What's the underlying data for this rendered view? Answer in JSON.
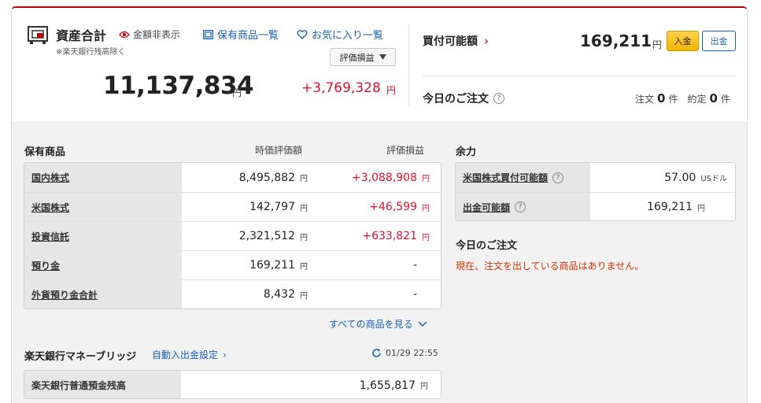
{
  "header": {
    "asset_title": "資産合計",
    "hide_amount_label": "金額非表示",
    "asset_note": "※楽天銀行残高除く",
    "link_holdings": "保有商品一覧",
    "link_favorites": "お気に入り一覧",
    "pl_select": "評価損益",
    "total_value": "11,137,834",
    "total_currency": "円",
    "total_pl": "+3,769,328",
    "total_pl_currency": "円"
  },
  "buying_power": {
    "label": "買付可能額",
    "value": "169,211",
    "currency": "円",
    "deposit_button": "入金",
    "withdraw_button": "出金"
  },
  "today_orders_top": {
    "label": "今日のご注文",
    "orders_label": "注文",
    "orders_count": "0",
    "orders_unit": "件",
    "executed_label": "約定",
    "executed_count": "0",
    "executed_unit": "件"
  },
  "holdings": {
    "title": "保有商品",
    "col_market_value": "時価評価額",
    "col_pl": "評価損益",
    "rows": [
      {
        "label": "国内株式",
        "value": "8,495,882",
        "currency": "円",
        "pl": "+3,088,908",
        "pl_currency": "円"
      },
      {
        "label": "米国株式",
        "value": "142,797",
        "currency": "円",
        "pl": "+46,599",
        "pl_currency": "円"
      },
      {
        "label": "投資信託",
        "value": "2,321,512",
        "currency": "円",
        "pl": "+633,821",
        "pl_currency": "円"
      },
      {
        "label": "預り金",
        "value": "169,211",
        "currency": "円",
        "pl": "-",
        "pl_currency": ""
      },
      {
        "label": "外貨預り金合計",
        "value": "8,432",
        "currency": "円",
        "pl": "-",
        "pl_currency": ""
      }
    ],
    "see_all": "すべての商品を見る"
  },
  "moneybridge": {
    "title": "楽天銀行マネーブリッジ",
    "auto_link": "自動入出金設定",
    "updated": "01/29 22:55",
    "row_label": "楽天銀行普通預金残高",
    "row_value": "1,655,817",
    "row_currency": "円"
  },
  "margin": {
    "title": "余力",
    "rows": [
      {
        "label": "米国株式買付可能額",
        "value": "57.00",
        "currency": "USドル"
      },
      {
        "label": "出金可能額",
        "value": "169,211",
        "currency": "円"
      }
    ]
  },
  "today_orders": {
    "title": "今日のご注文",
    "message": "現在、注文を出している商品はありません。"
  },
  "colors": {
    "brand_red": "#bf0000",
    "profit_red": "#e0102b",
    "link_blue": "#1a5fb4",
    "deposit_yellow": "#f5b400",
    "notice_orange": "#d63300"
  }
}
